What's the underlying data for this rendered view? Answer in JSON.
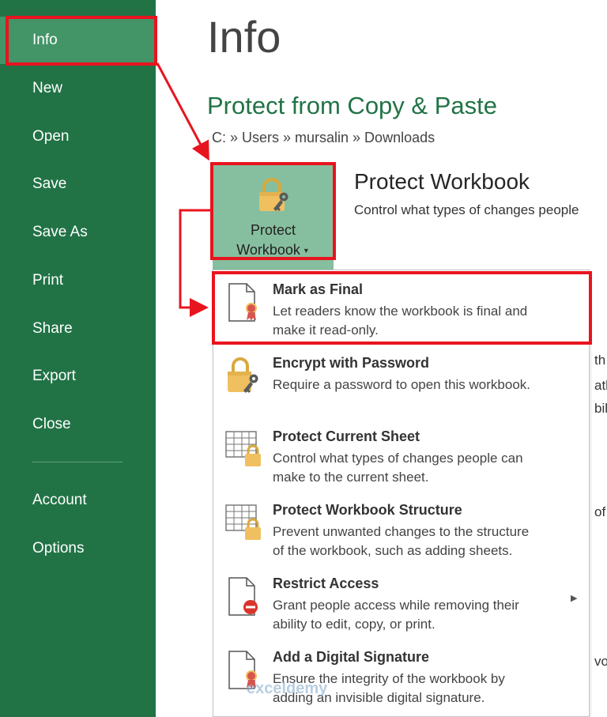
{
  "sidebar": {
    "items": [
      {
        "label": "Info",
        "active": true
      },
      {
        "label": "New"
      },
      {
        "label": "Open"
      },
      {
        "label": "Save"
      },
      {
        "label": "Save As"
      },
      {
        "label": "Print"
      },
      {
        "label": "Share"
      },
      {
        "label": "Export"
      },
      {
        "label": "Close"
      },
      {
        "label": "Account"
      },
      {
        "label": "Options"
      }
    ]
  },
  "main": {
    "page_title": "Info",
    "document_title": "Protect from Copy & Paste",
    "path": "C: » Users » mursalin » Downloads",
    "protect_button": {
      "line1": "Protect",
      "line2": "Workbook"
    },
    "section_heading": "Protect Workbook",
    "section_desc": "Control what types of changes people",
    "background_fragments": [
      "th",
      "ath",
      "bili",
      "of",
      "vor"
    ]
  },
  "menu": {
    "items": [
      {
        "title": "Mark as Final",
        "line1": "Let readers know the workbook is final and",
        "line2": "make it read-only.",
        "icon": "document-ribbon-icon"
      },
      {
        "title": "Encrypt with Password",
        "line1": "Require a password to open this workbook.",
        "line2": "",
        "icon": "lock-key-icon"
      },
      {
        "title": "Protect Current Sheet",
        "line1": "Control what types of changes people can",
        "line2": "make to the current sheet.",
        "icon": "sheet-lock-icon"
      },
      {
        "title": "Protect Workbook Structure",
        "line1": "Prevent unwanted changes to the structure",
        "line2": "of the workbook, such as adding sheets.",
        "icon": "sheet-lock-icon"
      },
      {
        "title": "Restrict Access",
        "line1": "Grant people access while removing their",
        "line2": "ability to edit, copy, or print.",
        "icon": "document-restrict-icon"
      },
      {
        "title": "Add a Digital Signature",
        "line1": "Ensure the integrity of the workbook by",
        "line2": "adding an invisible digital signature.",
        "icon": "document-ribbon-icon"
      }
    ]
  },
  "watermark": "exceldemy",
  "colors": {
    "sidebar": "#217346",
    "active": "#439467",
    "button": "#86bf9f",
    "annotation": "#e8141e",
    "lock": "#f0c060"
  }
}
